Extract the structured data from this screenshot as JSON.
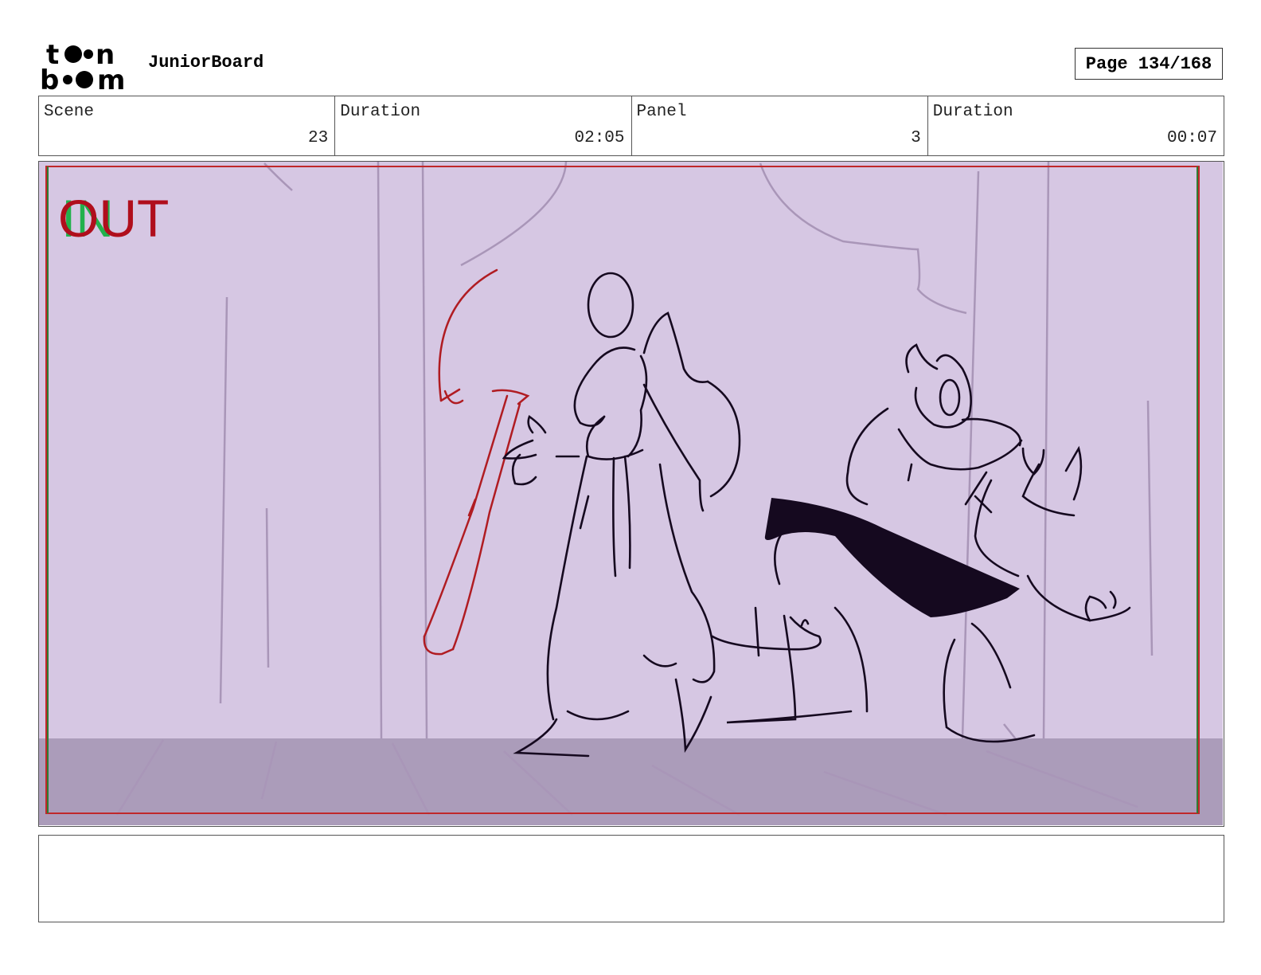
{
  "header": {
    "logo_text_line1": "toon",
    "logo_text_line2": "boom",
    "app_name": "JuniorBoard",
    "page_label": "Page 134/168"
  },
  "info": {
    "scene_label": "Scene",
    "scene_value": "23",
    "scene_duration_label": "Duration",
    "scene_duration_value": "02:05",
    "panel_label": "Panel",
    "panel_value": "3",
    "panel_duration_label": "Duration",
    "panel_duration_value": "00:07"
  },
  "panel": {
    "in_marker": "IN",
    "out_marker": "OUT",
    "background_color": "#d6c7e3",
    "floor_color": "#ab9cba",
    "action_stroke_color": "#c0282a",
    "line_color": "#15091f"
  },
  "notes": {
    "text": ""
  }
}
